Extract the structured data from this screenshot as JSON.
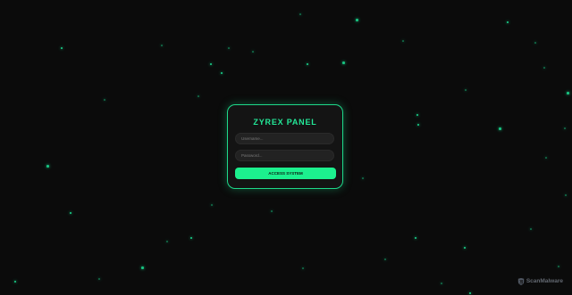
{
  "panel": {
    "title": "ZYREX PANEL",
    "username_placeholder": "Username...",
    "password_placeholder": "Password...",
    "submit_label": "ACCESS SYSTEM"
  },
  "watermark": {
    "text": "ScanMalware",
    "icon": "scanmalware-logo-icon"
  },
  "theme": {
    "background": "#0b0b0b",
    "accent": "#1cf08e",
    "card_background": "#141414",
    "field_background": "#222222"
  }
}
